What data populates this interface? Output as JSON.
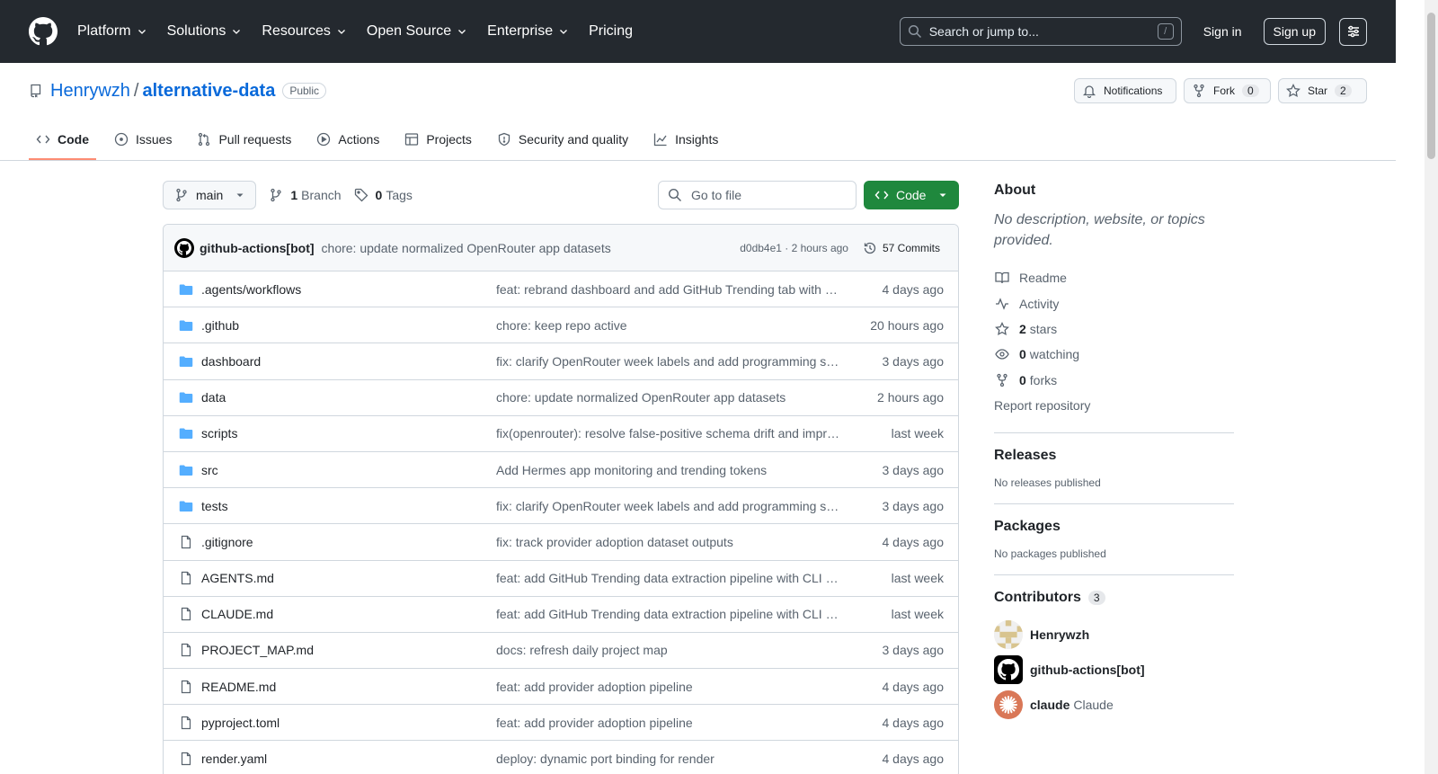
{
  "header": {
    "nav": [
      "Platform",
      "Solutions",
      "Resources",
      "Open Source",
      "Enterprise",
      "Pricing"
    ],
    "nav_has_chevron": [
      true,
      true,
      true,
      true,
      true,
      false
    ],
    "search_placeholder": "Search or jump to...",
    "search_shortcut": "/",
    "signin": "Sign in",
    "signup": "Sign up"
  },
  "repo": {
    "owner": "Henrywzh",
    "separator": "/",
    "name": "alternative-data",
    "visibility": "Public",
    "notifications_label": "Notifications",
    "fork_label": "Fork",
    "fork_count": "0",
    "star_label": "Star",
    "star_count": "2"
  },
  "tabs": [
    {
      "label": "Code",
      "icon": "code-icon",
      "active": true
    },
    {
      "label": "Issues",
      "icon": "issue-icon",
      "active": false
    },
    {
      "label": "Pull requests",
      "icon": "pull-request-icon",
      "active": false
    },
    {
      "label": "Actions",
      "icon": "play-icon",
      "active": false
    },
    {
      "label": "Projects",
      "icon": "table-icon",
      "active": false
    },
    {
      "label": "Security and quality",
      "icon": "shield-icon",
      "active": false
    },
    {
      "label": "Insights",
      "icon": "graph-icon",
      "active": false
    }
  ],
  "toolbar": {
    "branch": "main",
    "branch_count": "1",
    "branch_label": "Branch",
    "tag_count": "0",
    "tag_label": "Tags",
    "goto_placeholder": "Go to file",
    "code_label": "Code"
  },
  "latest_commit": {
    "author": "github-actions[bot]",
    "message": "chore: update normalized OpenRouter app datasets",
    "meta": "d0db4e1 · 2 hours ago",
    "commits": "57 Commits"
  },
  "files": [
    {
      "type": "dir",
      "name": ".agents/workflows",
      "message": "feat: rebrand dashboard and add GitHub Trending tab with h…",
      "age": "4 days ago"
    },
    {
      "type": "dir",
      "name": ".github",
      "message": "chore: keep repo active",
      "age": "20 hours ago"
    },
    {
      "type": "dir",
      "name": "dashboard",
      "message": "fix: clarify OpenRouter week labels and add programming se…",
      "age": "3 days ago"
    },
    {
      "type": "dir",
      "name": "data",
      "message": "chore: update normalized OpenRouter app datasets",
      "age": "2 hours ago"
    },
    {
      "type": "dir",
      "name": "scripts",
      "message": "fix(openrouter): resolve false-positive schema drift and impr…",
      "age": "last week"
    },
    {
      "type": "dir",
      "name": "src",
      "message": "Add Hermes app monitoring and trending tokens",
      "age": "3 days ago"
    },
    {
      "type": "dir",
      "name": "tests",
      "message": "fix: clarify OpenRouter week labels and add programming se…",
      "age": "3 days ago"
    },
    {
      "type": "file",
      "name": ".gitignore",
      "message": "fix: track provider adoption dataset outputs",
      "age": "4 days ago"
    },
    {
      "type": "file",
      "name": "AGENTS.md",
      "message": "feat: add GitHub Trending data extraction pipeline with CLI a…",
      "age": "last week"
    },
    {
      "type": "file",
      "name": "CLAUDE.md",
      "message": "feat: add GitHub Trending data extraction pipeline with CLI a…",
      "age": "last week"
    },
    {
      "type": "file",
      "name": "PROJECT_MAP.md",
      "message": "docs: refresh daily project map",
      "age": "3 days ago"
    },
    {
      "type": "file",
      "name": "README.md",
      "message": "feat: add provider adoption pipeline",
      "age": "4 days ago"
    },
    {
      "type": "file",
      "name": "pyproject.toml",
      "message": "feat: add provider adoption pipeline",
      "age": "4 days ago"
    },
    {
      "type": "file",
      "name": "render.yaml",
      "message": "deploy: dynamic port binding for render",
      "age": "4 days ago"
    }
  ],
  "sidebar": {
    "about_title": "About",
    "about_desc": "No description, website, or topics provided.",
    "readme": "Readme",
    "activity": "Activity",
    "stars_count": "2",
    "stars_label": "stars",
    "watching_count": "0",
    "watching_label": "watching",
    "forks_count": "0",
    "forks_label": "forks",
    "report": "Report repository",
    "releases_title": "Releases",
    "releases_empty": "No releases published",
    "packages_title": "Packages",
    "packages_empty": "No packages published",
    "contributors_title": "Contributors",
    "contributors_count": "3",
    "contributors": [
      {
        "login": "Henrywzh",
        "name": ""
      },
      {
        "login": "github-actions[bot]",
        "name": ""
      },
      {
        "login": "claude",
        "name": "Claude"
      }
    ]
  },
  "colors": {
    "header_bg": "#24292f",
    "link": "#0969da",
    "primary_button": "#1f883d",
    "active_tab_underline": "#fd8c73",
    "folder_icon": "#54aeff"
  }
}
